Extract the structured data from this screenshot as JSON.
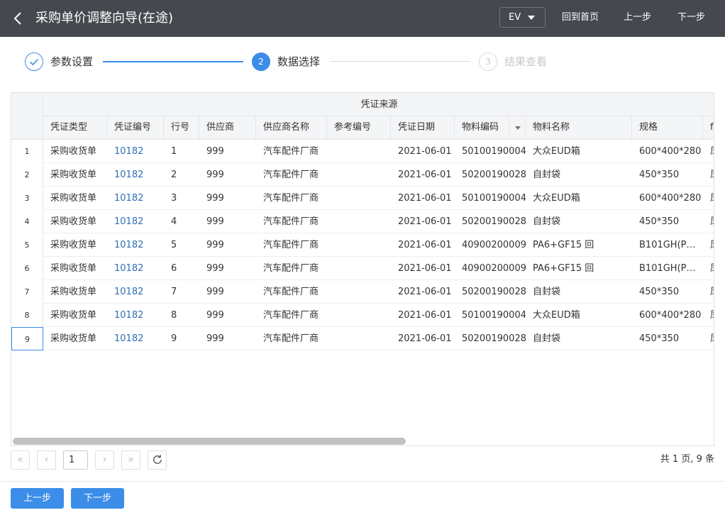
{
  "header": {
    "title": "采购单价调整向导(在途)",
    "ev_label": "EV",
    "home_label": "回到首页",
    "prev_label": "上一步",
    "next_label": "下一步"
  },
  "steps": [
    {
      "number": "1",
      "label": "参数设置",
      "state": "done"
    },
    {
      "number": "2",
      "label": "数据选择",
      "state": "active"
    },
    {
      "number": "3",
      "label": "结果查看",
      "state": "pending"
    }
  ],
  "table": {
    "group_header": "凭证来源",
    "columns": [
      "凭证类型",
      "凭证编号",
      "行号",
      "供应商",
      "供应商名称",
      "参考编号",
      "凭证日期",
      "物料编码",
      "物料名称",
      "规格",
      "f"
    ],
    "rows": [
      {
        "n": "1",
        "type": "采购收货单",
        "doc": "10182",
        "line": "1",
        "vendor": "999",
        "vname": "汽车配件厂商",
        "ref": "",
        "date": "2021-06-01",
        "code": "50100190004",
        "name": "大众EUD箱",
        "spec": "600*400*280",
        "extra": "凤"
      },
      {
        "n": "2",
        "type": "采购收货单",
        "doc": "10182",
        "line": "2",
        "vendor": "999",
        "vname": "汽车配件厂商",
        "ref": "",
        "date": "2021-06-01",
        "code": "50200190028",
        "name": "自封袋",
        "spec": "450*350",
        "extra": "凤"
      },
      {
        "n": "3",
        "type": "采购收货单",
        "doc": "10182",
        "line": "3",
        "vendor": "999",
        "vname": "汽车配件厂商",
        "ref": "",
        "date": "2021-06-01",
        "code": "50100190004",
        "name": "大众EUD箱",
        "spec": "600*400*280",
        "extra": "凤"
      },
      {
        "n": "4",
        "type": "采购收货单",
        "doc": "10182",
        "line": "4",
        "vendor": "999",
        "vname": "汽车配件厂商",
        "ref": "",
        "date": "2021-06-01",
        "code": "50200190028",
        "name": "自封袋",
        "spec": "450*350",
        "extra": "凤"
      },
      {
        "n": "5",
        "type": "采购收货单",
        "doc": "10182",
        "line": "5",
        "vendor": "999",
        "vname": "汽车配件厂商",
        "ref": "",
        "date": "2021-06-01",
        "code": "40900200009",
        "name": "PA6+GF15 回",
        "spec": "B101GH(P…",
        "extra": "凤"
      },
      {
        "n": "6",
        "type": "采购收货单",
        "doc": "10182",
        "line": "6",
        "vendor": "999",
        "vname": "汽车配件厂商",
        "ref": "",
        "date": "2021-06-01",
        "code": "40900200009",
        "name": "PA6+GF15 回",
        "spec": "B101GH(P…",
        "extra": "凤"
      },
      {
        "n": "7",
        "type": "采购收货单",
        "doc": "10182",
        "line": "7",
        "vendor": "999",
        "vname": "汽车配件厂商",
        "ref": "",
        "date": "2021-06-01",
        "code": "50200190028",
        "name": "自封袋",
        "spec": "450*350",
        "extra": "凤"
      },
      {
        "n": "8",
        "type": "采购收货单",
        "doc": "10182",
        "line": "8",
        "vendor": "999",
        "vname": "汽车配件厂商",
        "ref": "",
        "date": "2021-06-01",
        "code": "50100190004",
        "name": "大众EUD箱",
        "spec": "600*400*280",
        "extra": "凤"
      },
      {
        "n": "9",
        "type": "采购收货单",
        "doc": "10182",
        "line": "9",
        "vendor": "999",
        "vname": "汽车配件厂商",
        "ref": "",
        "date": "2021-06-01",
        "code": "50200190028",
        "name": "自封袋",
        "spec": "450*350",
        "extra": "凤"
      }
    ]
  },
  "pager": {
    "first": "«",
    "prev": "‹",
    "page": "1",
    "next": "›",
    "last": "»",
    "info": "共 1 页, 9 条"
  },
  "footer": {
    "prev_label": "上一步",
    "next_label": "下一步"
  },
  "colors": {
    "header_bg": "#45494f",
    "accent": "#3b8de8",
    "link": "#2f6eb5"
  }
}
